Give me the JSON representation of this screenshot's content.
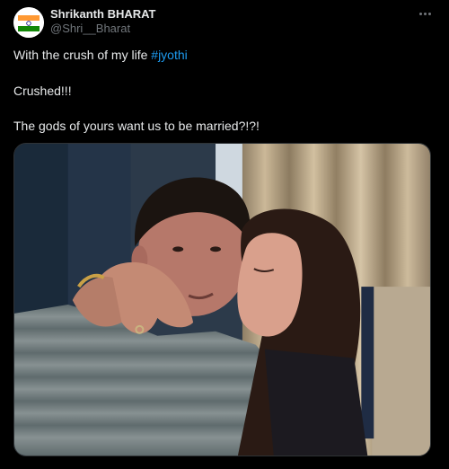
{
  "author": {
    "name": "Shrikanth BHARAT",
    "handle": "@Shri__Bharat",
    "avatar_icon": "india-flag-avatar-icon"
  },
  "more_icon": "more-options-icon",
  "tweet": {
    "line1_prefix": "With the crush of my life ",
    "hashtag": "#jyothi",
    "line2": "Crushed!!!",
    "line3": "The gods of yours want us to be married?!?!"
  },
  "media": {
    "description_icon": "selfie-photo"
  },
  "colors": {
    "background": "#000000",
    "text": "#e7e9ea",
    "secondary": "#71767b",
    "link": "#1d9bf0"
  }
}
